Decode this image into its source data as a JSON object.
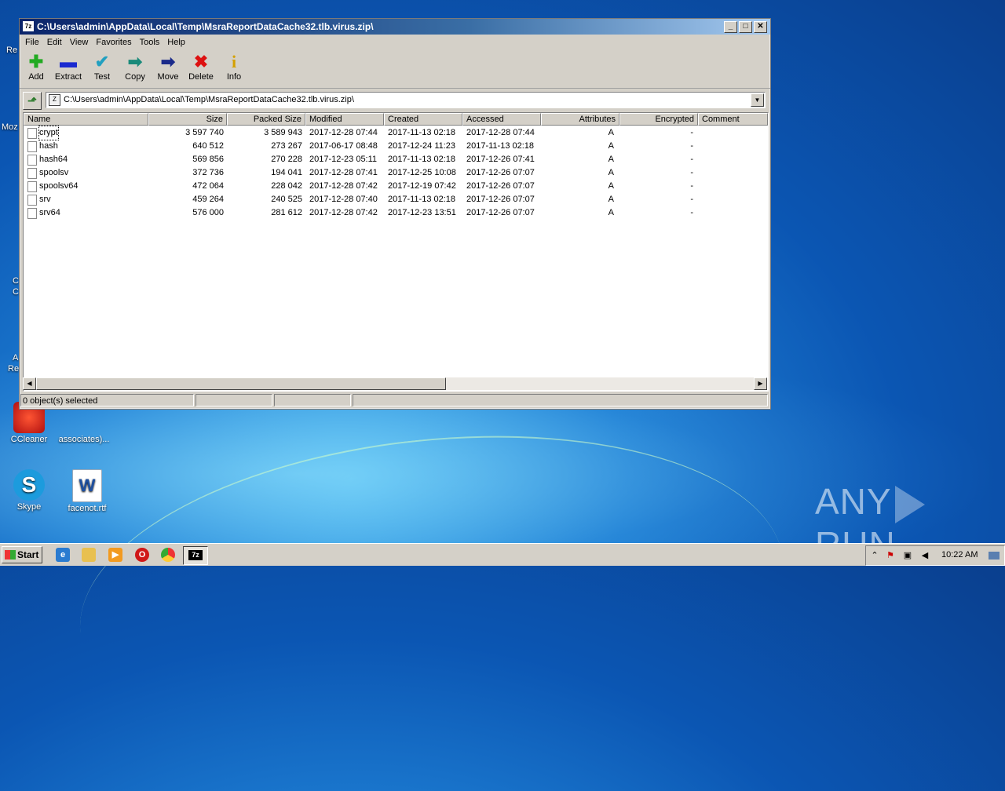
{
  "window": {
    "title": "C:\\Users\\admin\\AppData\\Local\\Temp\\MsraReportDataCache32.tlb.virus.zip\\",
    "app_icon": "7z"
  },
  "menu": [
    "File",
    "Edit",
    "View",
    "Favorites",
    "Tools",
    "Help"
  ],
  "toolbar": [
    {
      "label": "Add",
      "icon": "plus-icon",
      "glyph": "✚",
      "color": "#22aa22"
    },
    {
      "label": "Extract",
      "icon": "minus-icon",
      "glyph": "▬",
      "color": "#1a2ad0"
    },
    {
      "label": "Test",
      "icon": "check-icon",
      "glyph": "✔",
      "color": "#22a0c0"
    },
    {
      "label": "Copy",
      "icon": "copy-arrow-icon",
      "glyph": "➡",
      "color": "#1a8a7a"
    },
    {
      "label": "Move",
      "icon": "move-arrow-icon",
      "glyph": "➡",
      "color": "#1a2a8a"
    },
    {
      "label": "Delete",
      "icon": "delete-x-icon",
      "glyph": "✖",
      "color": "#dd1111"
    },
    {
      "label": "Info",
      "icon": "info-icon",
      "glyph": "i",
      "color": "#d4a000"
    }
  ],
  "address": {
    "path": "C:\\Users\\admin\\AppData\\Local\\Temp\\MsraReportDataCache32.tlb.virus.zip\\"
  },
  "columns": [
    "Name",
    "Size",
    "Packed Size",
    "Modified",
    "Created",
    "Accessed",
    "Attributes",
    "Encrypted",
    "Comment"
  ],
  "files": [
    {
      "name": "crypt",
      "size": "3 597 740",
      "packed": "3 589 943",
      "modified": "2017-12-28 07:44",
      "created": "2017-11-13 02:18",
      "accessed": "2017-12-28 07:44",
      "attr": "A",
      "enc": "-"
    },
    {
      "name": "hash",
      "size": "640 512",
      "packed": "273 267",
      "modified": "2017-06-17 08:48",
      "created": "2017-12-24 11:23",
      "accessed": "2017-11-13 02:18",
      "attr": "A",
      "enc": "-"
    },
    {
      "name": "hash64",
      "size": "569 856",
      "packed": "270 228",
      "modified": "2017-12-23 05:11",
      "created": "2017-11-13 02:18",
      "accessed": "2017-12-26 07:41",
      "attr": "A",
      "enc": "-"
    },
    {
      "name": "spoolsv",
      "size": "372 736",
      "packed": "194 041",
      "modified": "2017-12-28 07:41",
      "created": "2017-12-25 10:08",
      "accessed": "2017-12-26 07:07",
      "attr": "A",
      "enc": "-"
    },
    {
      "name": "spoolsv64",
      "size": "472 064",
      "packed": "228 042",
      "modified": "2017-12-28 07:42",
      "created": "2017-12-19 07:42",
      "accessed": "2017-12-26 07:07",
      "attr": "A",
      "enc": "-"
    },
    {
      "name": "srv",
      "size": "459 264",
      "packed": "240 525",
      "modified": "2017-12-28 07:40",
      "created": "2017-11-13 02:18",
      "accessed": "2017-12-26 07:07",
      "attr": "A",
      "enc": "-"
    },
    {
      "name": "srv64",
      "size": "576 000",
      "packed": "281 612",
      "modified": "2017-12-28 07:42",
      "created": "2017-12-23 13:51",
      "accessed": "2017-12-26 07:07",
      "attr": "A",
      "enc": "-"
    }
  ],
  "status": {
    "selected": "0 object(s) selected"
  },
  "desktop": {
    "icons": [
      {
        "label": "CCleaner",
        "icon": "ccleaner-icon"
      },
      {
        "label": "associates)...",
        "icon": "document-icon"
      },
      {
        "label": "Skype",
        "icon": "skype-icon"
      },
      {
        "label": "facenot.rtf",
        "icon": "word-document-icon"
      }
    ],
    "partial_labels": [
      "Re",
      "Moz",
      "C",
      "C",
      "A",
      "Re"
    ]
  },
  "watermark": {
    "left": "ANY",
    "right": "RUN"
  },
  "taskbar": {
    "start_label": "Start",
    "clock": "10:22 AM",
    "active_app": "7z"
  }
}
